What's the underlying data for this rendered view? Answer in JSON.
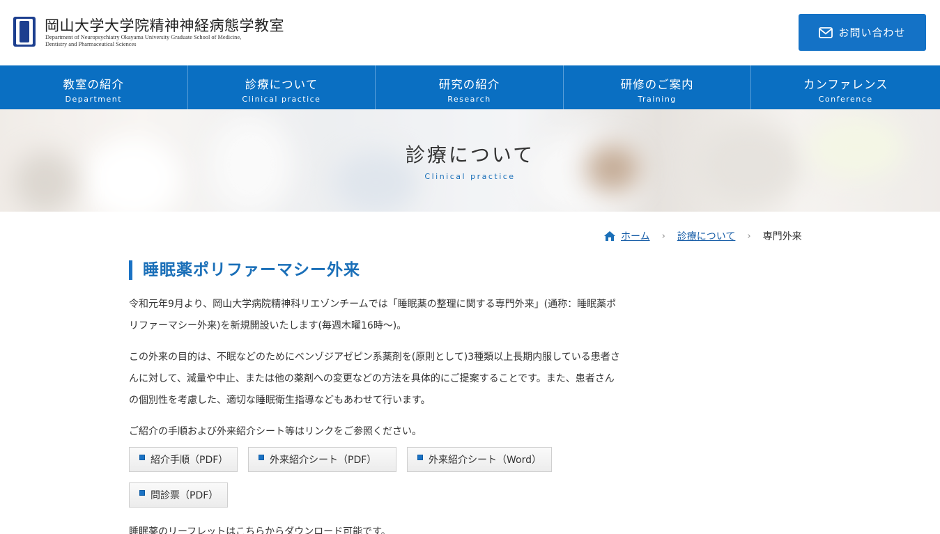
{
  "header": {
    "logo_title": "岡山大学大学院精神神経病態学教室",
    "logo_sub_line1": "Department of Neuropsychiatry Okayama University Graduate School of Medicine,",
    "logo_sub_line2": "Dentistry and Pharmaceutical Sciences",
    "contact_label": "お問い合わせ",
    "contact_icon": "mail-icon"
  },
  "nav": {
    "items": [
      {
        "jp": "教室の紹介",
        "en": "Department"
      },
      {
        "jp": "診療について",
        "en": "Clinical practice"
      },
      {
        "jp": "研究の紹介",
        "en": "Research"
      },
      {
        "jp": "研修のご案内",
        "en": "Training"
      },
      {
        "jp": "カンファレンス",
        "en": "Conference"
      }
    ]
  },
  "hero": {
    "title": "診療について",
    "subtitle": "Clinical practice"
  },
  "breadcrumb": {
    "home_icon": "home-icon",
    "home": "ホーム",
    "parent": "診療について",
    "current": "専門外来",
    "separator": "›"
  },
  "content": {
    "title": "睡眠薬ポリファーマシー外来",
    "paragraphs": [
      "令和元年9月より、岡山大学病院精神科リエゾンチームでは「睡眠薬の整理に関する専門外来」(通称：睡眠薬ポリファーマシー外来)を新規開設いたします(毎週木曜16時～)。",
      "この外来の目的は、不眠などのためにベンゾジアゼピン系薬剤を(原則として)3種類以上長期内服している患者さんに対して、減量や中止、または他の薬剤への変更などの方法を具体的にご提案することです。また、患者さんの個別性を考慮した、適切な睡眠衛生指導などもあわせて行います。",
      "ご紹介の手順および外来紹介シート等はリンクをご参照ください。",
      "睡眠薬のリーフレットはこちらからダウンロード可能です。"
    ],
    "links": [
      "紹介手順（PDF）",
      "外来紹介シート（PDF）",
      "外来紹介シート（Word）",
      "問診票（PDF）"
    ]
  },
  "colors": {
    "primary": "#0a6fc2",
    "title_blue": "#1a6fb8",
    "text": "#333333"
  }
}
